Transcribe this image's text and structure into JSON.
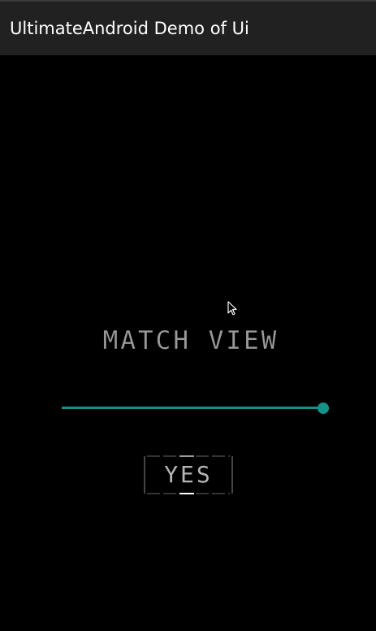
{
  "app_bar": {
    "title": "UltimateAndroid Demo of Ui",
    "background": "#212121"
  },
  "main": {
    "match_view_text": "MATCH VIEW",
    "slider": {
      "value": 1.0,
      "accent": "#129389"
    },
    "yes_button": {
      "label": "YES"
    }
  },
  "cursor": {
    "icon": "mouse-pointer-icon"
  }
}
